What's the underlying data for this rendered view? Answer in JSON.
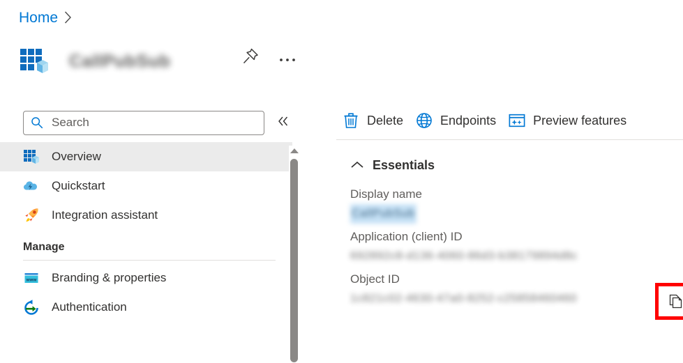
{
  "breadcrumb": {
    "home_label": "Home",
    "separator": "›"
  },
  "header": {
    "title": "CallPubSub",
    "icon": "app-registration-icon",
    "pin_icon": "pin-icon",
    "more_icon": "ellipsis-icon"
  },
  "sidebar": {
    "search": {
      "placeholder": "Search",
      "value": "",
      "icon": "search-icon"
    },
    "collapse_label": "«",
    "items": [
      {
        "label": "Overview",
        "icon": "overview-icon",
        "selected": true
      },
      {
        "label": "Quickstart",
        "icon": "quickstart-cloud-icon",
        "selected": false
      },
      {
        "label": "Integration assistant",
        "icon": "rocket-icon",
        "selected": false
      }
    ],
    "section_manage": "Manage",
    "manage_items": [
      {
        "label": "Branding & properties",
        "icon": "www-browser-icon"
      },
      {
        "label": "Authentication",
        "icon": "authentication-arrow-icon"
      }
    ]
  },
  "toolbar": {
    "buttons": [
      {
        "label": "Delete",
        "icon": "trash-icon"
      },
      {
        "label": "Endpoints",
        "icon": "globe-icon"
      },
      {
        "label": "Preview features",
        "icon": "preview-features-icon"
      }
    ]
  },
  "main": {
    "essentials": {
      "title": "Essentials",
      "chevron": "chevron-up-icon",
      "properties": [
        {
          "label": "Display name",
          "value": "CallPubSub",
          "selected": true
        },
        {
          "label": "Application (client) ID",
          "value": "692892c8-d136-4060-86d3-b38179894d8c",
          "selected": false
        },
        {
          "label": "Object ID",
          "value": "1c821c02-4630-47a0-8252-c25858460460",
          "selected": false
        }
      ],
      "copy_button": {
        "icon": "copy-icon",
        "highlight_color": "#ff0000"
      }
    }
  },
  "colors": {
    "accent": "#0078d4",
    "text": "#323130",
    "muted": "#605e5c",
    "selected_row": "#ebebeb",
    "highlight": "#ff0000"
  }
}
